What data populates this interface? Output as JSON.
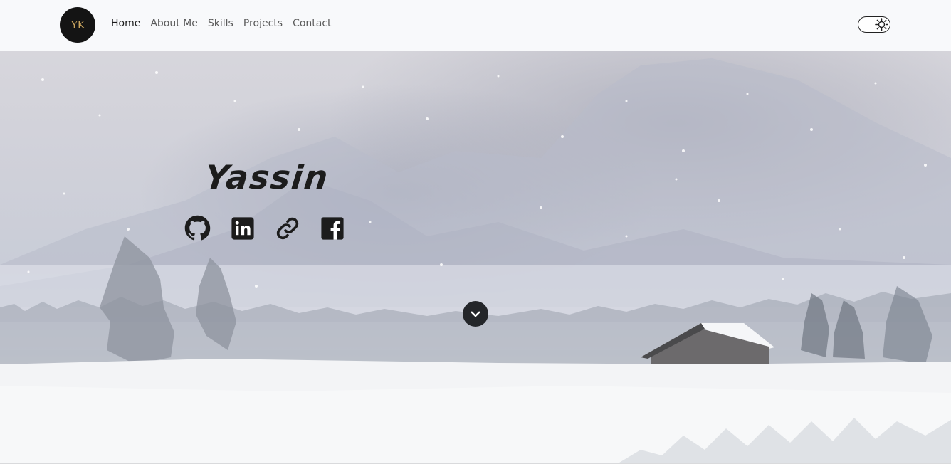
{
  "navbar": {
    "logo_text": "YK",
    "links": [
      {
        "label": "Home",
        "active": true
      },
      {
        "label": "About Me",
        "active": false
      },
      {
        "label": "Skills",
        "active": false
      },
      {
        "label": "Projects",
        "active": false
      },
      {
        "label": "Contact",
        "active": false
      }
    ],
    "theme_toggle_icon": "sun-icon"
  },
  "hero": {
    "name": "Yassin",
    "social_icons": [
      "github-icon",
      "linkedin-icon",
      "link-icon",
      "facebook-icon"
    ],
    "scroll_icon": "chevron-down-icon",
    "background": "snowy-mountain-landscape-with-cabin"
  },
  "colors": {
    "navbar_bg": "#f8f9fb",
    "navbar_border": "#8fd3e3",
    "text_dark": "#1c1c1c",
    "logo_gold": "#c9a45e"
  }
}
